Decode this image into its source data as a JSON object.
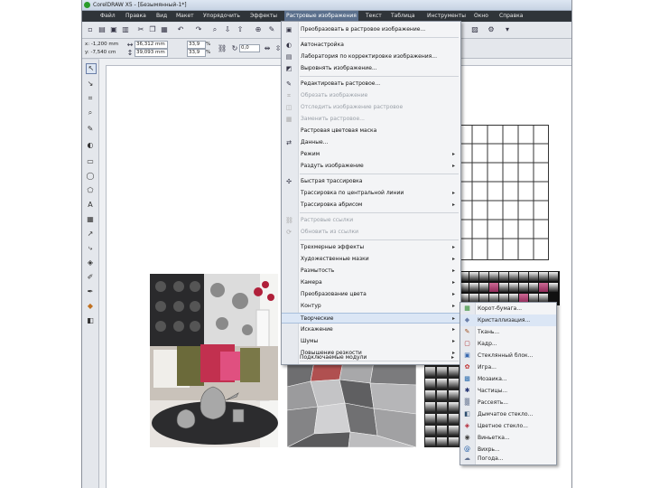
{
  "window": {
    "title": "CorelDRAW X5 - [Безымянный-1*]"
  },
  "menubar": {
    "items": [
      {
        "label": "Файл"
      },
      {
        "label": "Правка"
      },
      {
        "label": "Вид"
      },
      {
        "label": "Макет"
      },
      {
        "label": "Упорядочить"
      },
      {
        "label": "Эффекты"
      },
      {
        "label": "Растровые изображения",
        "active": true
      },
      {
        "label": "Текст"
      },
      {
        "label": "Таблица"
      },
      {
        "label": "Инструменты"
      },
      {
        "label": "Окно"
      },
      {
        "label": "Справка"
      }
    ]
  },
  "propertybar": {
    "x": "x: -1,200 mm",
    "y": "y: -7,540 cm",
    "width": "36,312 mm",
    "height": "39,093 mm",
    "scale_w": "33,9",
    "scale_h": "33,9",
    "pct": "%",
    "angle": "0,0"
  },
  "bitmaps_menu": {
    "items": [
      {
        "label": "Преобразовать в растровое изображение...",
        "icon": "convert-icon",
        "disabled": false,
        "submenu": false
      },
      {
        "label": "Автонастройка",
        "icon": "auto-adjust-icon",
        "disabled": false,
        "submenu": false
      },
      {
        "label": "Лаборатория по корректировке изображения...",
        "icon": "lab-icon",
        "disabled": false,
        "submenu": false
      },
      {
        "label": "Выровнять изображение...",
        "icon": "straighten-icon",
        "disabled": false,
        "submenu": false
      },
      {
        "label": "Редактировать растровое...",
        "icon": "edit-bitmap-icon",
        "disabled": false,
        "submenu": false
      },
      {
        "label": "Обрезать изображение",
        "icon": "crop-icon",
        "disabled": true,
        "submenu": false
      },
      {
        "label": "Отследить изображение растровое",
        "icon": "trace-icon",
        "disabled": true,
        "submenu": false
      },
      {
        "label": "Заменить растровое...",
        "icon": "resample-icon",
        "disabled": true,
        "submenu": false
      },
      {
        "label": "Растровая цветовая маска",
        "icon": "color-mask-icon",
        "disabled": false,
        "submenu": false
      },
      {
        "label": "Данные...",
        "icon": "data-icon",
        "disabled": false,
        "submenu": false
      },
      {
        "label": "Режим",
        "icon": "",
        "disabled": false,
        "submenu": true
      },
      {
        "label": "Раздуть изображение",
        "icon": "",
        "disabled": false,
        "submenu": true
      },
      {
        "label": "Быстрая трассировка",
        "icon": "quick-trace-icon",
        "disabled": false,
        "submenu": false
      },
      {
        "label": "Трассировка по центральной линии",
        "icon": "",
        "disabled": false,
        "submenu": true
      },
      {
        "label": "Трассировка абрисом",
        "icon": "",
        "disabled": false,
        "submenu": true
      },
      {
        "label": "Растровые ссылки",
        "icon": "link-icon",
        "disabled": true,
        "submenu": false
      },
      {
        "label": "Обновить из ссылки",
        "icon": "update-link-icon",
        "disabled": true,
        "submenu": false
      },
      {
        "label": "Трехмерные эффекты",
        "icon": "",
        "disabled": false,
        "submenu": true
      },
      {
        "label": "Художественные мазки",
        "icon": "",
        "disabled": false,
        "submenu": true
      },
      {
        "label": "Размытость",
        "icon": "",
        "disabled": false,
        "submenu": true
      },
      {
        "label": "Камера",
        "icon": "",
        "disabled": false,
        "submenu": true
      },
      {
        "label": "Преобразование цвета",
        "icon": "",
        "disabled": false,
        "submenu": true
      },
      {
        "label": "Контур",
        "icon": "",
        "disabled": false,
        "submenu": true
      },
      {
        "label": "Творческие",
        "icon": "",
        "disabled": false,
        "submenu": true,
        "highlighted": true
      },
      {
        "label": "Искажение",
        "icon": "",
        "disabled": false,
        "submenu": true
      },
      {
        "label": "Шумы",
        "icon": "",
        "disabled": false,
        "submenu": true
      },
      {
        "label": "Повышение резкости",
        "icon": "",
        "disabled": false,
        "submenu": true
      },
      {
        "label": "Подключаемые модули",
        "icon": "",
        "disabled": false,
        "submenu": true
      }
    ]
  },
  "creative_submenu": {
    "items": [
      {
        "label": "Корот-бумага...",
        "icon": "crafts-icon",
        "color": "#2a8a2a"
      },
      {
        "label": "Кристаллизация...",
        "icon": "crystalize-icon",
        "color": "#6a7ea8",
        "highlighted": true
      },
      {
        "label": "Ткань...",
        "icon": "fabric-icon",
        "color": "#a05020"
      },
      {
        "label": "Кадр...",
        "icon": "frame-icon",
        "color": "#b03030"
      },
      {
        "label": "Стеклянный блок...",
        "icon": "glass-block-icon",
        "color": "#3a6ab0"
      },
      {
        "label": "Игра...",
        "icon": "kids-play-icon",
        "color": "#c03030"
      },
      {
        "label": "Мозаика...",
        "icon": "mosaic-icon",
        "color": "#2f6fb0"
      },
      {
        "label": "Частицы...",
        "icon": "particles-icon",
        "color": "#203070"
      },
      {
        "label": "Рассеять...",
        "icon": "scatter-icon",
        "color": "#506080"
      },
      {
        "label": "Дымчатое стекло...",
        "icon": "smoked-glass-icon",
        "color": "#305070"
      },
      {
        "label": "Цветное стекло...",
        "icon": "stained-glass-icon",
        "color": "#b02030"
      },
      {
        "label": "Виньетка...",
        "icon": "vignette-icon",
        "color": "#404040"
      },
      {
        "label": "Вихрь...",
        "icon": "vortex-icon",
        "color": "#1050a0"
      },
      {
        "label": "Погода...",
        "icon": "weather-icon",
        "color": "#607090"
      }
    ]
  }
}
